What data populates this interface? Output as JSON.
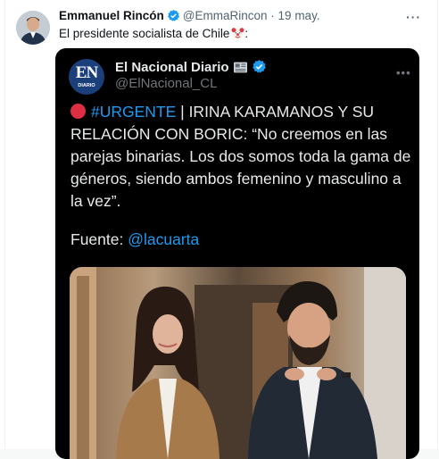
{
  "tweet": {
    "author_name": "Emmanuel Rincón",
    "author_handle": "@EmmaRincon",
    "separator": "·",
    "date": "19 may.",
    "text": "El presidente socialista de Chile",
    "trailing_emoji": "clown-face-icon"
  },
  "quoted": {
    "logo_text": "EN",
    "logo_subtext": "DIARIO",
    "name": "El Nacional Diario",
    "name_icon": "newspaper-icon",
    "handle": "@ElNacional_CL",
    "hashtag": "#URGENTE",
    "body": " | IRINA KARAMANOS Y SU RELACIÓN CON BORIC: “No creemos en las parejas binarias. Los dos somos toda la gama de géneros, siendo ambos femenino y masculino a la vez”.",
    "source_label": "Fuente: ",
    "source_mention": "@lacuarta"
  },
  "colors": {
    "verified_blue": "#1d9bf0",
    "link_blue": "#1d9bf0",
    "urgent_red": "#dd2e44",
    "quoted_background": "#000000"
  }
}
